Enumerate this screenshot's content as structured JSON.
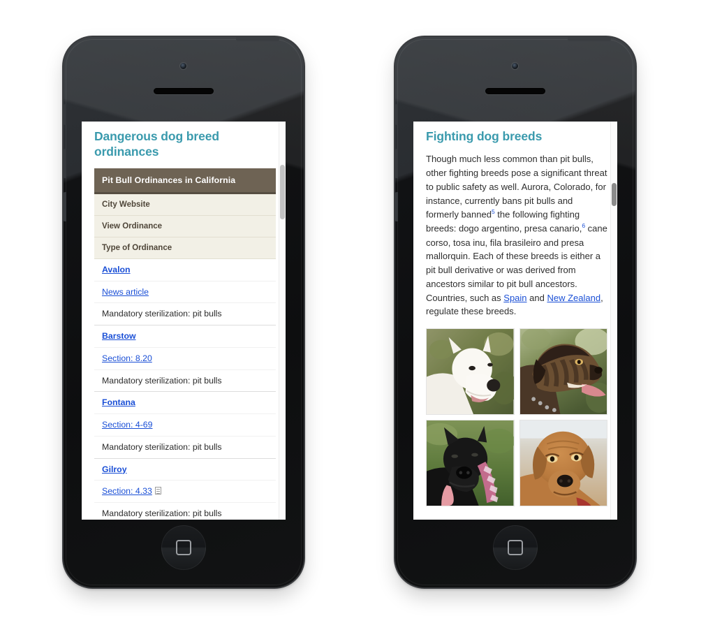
{
  "theme": {
    "accent_teal": "#3a9aad",
    "table_header_brown": "#6e6354",
    "table_subheader_cream": "#f2f0e6",
    "link_blue": "#1a4fd6",
    "page_background": "#ffffff"
  },
  "devices": [
    {
      "name": "left-phone",
      "hardware": {
        "camera": "camera-icon",
        "speaker": "speaker-grille",
        "home_button": "home-button",
        "power_button": "power-button",
        "mute_switch": "mute-switch",
        "volume_up": "volume-up-button",
        "volume_down": "volume-down-button"
      }
    },
    {
      "name": "right-phone",
      "hardware": {
        "camera": "camera-icon",
        "speaker": "speaker-grille",
        "home_button": "home-button",
        "power_button": "power-button",
        "mute_switch": "mute-switch",
        "volume_up": "volume-up-button",
        "volume_down": "volume-down-button"
      }
    }
  ],
  "left_screen": {
    "title": "Dangerous dog breed ordinances",
    "table": {
      "caption": "Pit Bull Ordinances in California",
      "column_headers": [
        "City Website",
        "View Ordinance",
        "Type of Ordinance"
      ],
      "rows": [
        {
          "city": "Avalon",
          "ordinance_link": "News article",
          "ordinance_type": "Mandatory sterilization: pit bulls",
          "has_doc_icon": false
        },
        {
          "city": "Barstow",
          "ordinance_link": "Section: 8.20",
          "ordinance_type": "Mandatory sterilization: pit bulls",
          "has_doc_icon": false
        },
        {
          "city": "Fontana",
          "ordinance_link": "Section: 4-69",
          "ordinance_type": "Mandatory sterilization: pit bulls",
          "has_doc_icon": false
        },
        {
          "city": "Gilroy",
          "ordinance_link": "Section: 4.33",
          "ordinance_type": "Mandatory sterilization: pit bulls",
          "has_doc_icon": true
        }
      ]
    },
    "scrollbar": {
      "thumb_position": "near-top"
    }
  },
  "right_screen": {
    "title": "Fighting dog breeds",
    "paragraph": {
      "part1": "Though much less common than pit bulls, other fighting breeds pose a significant threat to public safety as well. Aurora, Colorado, for instance, currently bans pit bulls and formerly banned",
      "ref1": "5",
      "part2": " the following fighting breeds: dogo argentino, presa canario,",
      "ref2": "6",
      "part3": " cane corso, tosa inu, fila brasileiro and presa mallorquin. Each of these breeds is either a pit bull derivative or was derived from ancestors similar to pit bull ancestors. Countries, such as ",
      "link1": "Spain",
      "part4": " and ",
      "link2": "New Zealand",
      "part5": ", regulate these breeds."
    },
    "images": [
      {
        "name": "dogo-argentino-photo",
        "alt": "White dogo argentino head portrait on green foliage background"
      },
      {
        "name": "presa-canario-photo",
        "alt": "Brindle presa canario in profile with tongue out"
      },
      {
        "name": "cane-corso-photo",
        "alt": "Black cane corso with pink collar on grass"
      },
      {
        "name": "tosa-inu-photo",
        "alt": "Tan tosa inu head portrait"
      }
    ],
    "scrollbar": {
      "thumb_position": "upper"
    }
  }
}
